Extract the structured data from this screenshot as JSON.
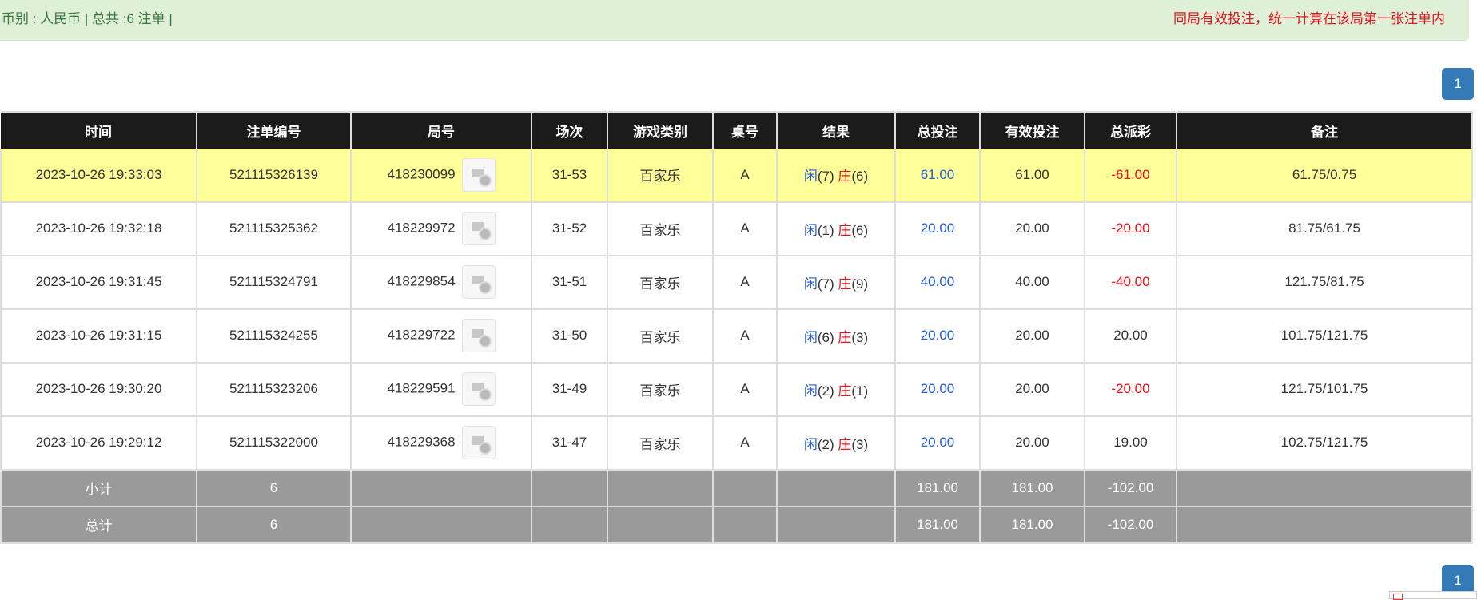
{
  "summary": {
    "left": "币别 : 人民币 | 总共 :6 注单 |",
    "right": "同局有效投注，统一计算在该局第一张注单内"
  },
  "pagination": {
    "top_page": "1",
    "bottom_page": "1"
  },
  "columns": [
    "时间",
    "注单编号",
    "局号",
    "场次",
    "游戏类别",
    "桌号",
    "结果",
    "总投注",
    "有效投注",
    "总派彩",
    "备注"
  ],
  "rows": [
    {
      "time": "2023-10-26 19:33:03",
      "bet_id": "521115326139",
      "round": "418230099",
      "session": "31-53",
      "game": "百家乐",
      "table": "A",
      "player": "闲",
      "player_pts": "(7)",
      "banker": "庄",
      "banker_pts": "(6)",
      "total": "61.00",
      "valid": "61.00",
      "payout": "-61.00",
      "payout_neg": true,
      "note": "61.75/0.75"
    },
    {
      "time": "2023-10-26 19:32:18",
      "bet_id": "521115325362",
      "round": "418229972",
      "session": "31-52",
      "game": "百家乐",
      "table": "A",
      "player": "闲",
      "player_pts": "(1)",
      "banker": "庄",
      "banker_pts": "(6)",
      "total": "20.00",
      "valid": "20.00",
      "payout": "-20.00",
      "payout_neg": true,
      "note": "81.75/61.75"
    },
    {
      "time": "2023-10-26 19:31:45",
      "bet_id": "521115324791",
      "round": "418229854",
      "session": "31-51",
      "game": "百家乐",
      "table": "A",
      "player": "闲",
      "player_pts": "(7)",
      "banker": "庄",
      "banker_pts": "(9)",
      "total": "40.00",
      "valid": "40.00",
      "payout": "-40.00",
      "payout_neg": true,
      "note": "121.75/81.75"
    },
    {
      "time": "2023-10-26 19:31:15",
      "bet_id": "521115324255",
      "round": "418229722",
      "session": "31-50",
      "game": "百家乐",
      "table": "A",
      "player": "闲",
      "player_pts": "(6)",
      "banker": "庄",
      "banker_pts": "(3)",
      "total": "20.00",
      "valid": "20.00",
      "payout": "20.00",
      "payout_neg": false,
      "note": "101.75/121.75"
    },
    {
      "time": "2023-10-26 19:30:20",
      "bet_id": "521115323206",
      "round": "418229591",
      "session": "31-49",
      "game": "百家乐",
      "table": "A",
      "player": "闲",
      "player_pts": "(2)",
      "banker": "庄",
      "banker_pts": "(1)",
      "total": "20.00",
      "valid": "20.00",
      "payout": "-20.00",
      "payout_neg": true,
      "note": "121.75/101.75"
    },
    {
      "time": "2023-10-26 19:29:12",
      "bet_id": "521115322000",
      "round": "418229368",
      "session": "31-47",
      "game": "百家乐",
      "table": "A",
      "player": "闲",
      "player_pts": "(2)",
      "banker": "庄",
      "banker_pts": "(3)",
      "total": "20.00",
      "valid": "20.00",
      "payout": "19.00",
      "payout_neg": false,
      "note": "102.75/121.75"
    }
  ],
  "subtotal": {
    "label": "小计",
    "count": "6",
    "total": "181.00",
    "valid": "181.00",
    "payout": "-102.00"
  },
  "grandtotal": {
    "label": "总计",
    "count": "6",
    "total": "181.00",
    "valid": "181.00",
    "payout": "-102.00"
  }
}
